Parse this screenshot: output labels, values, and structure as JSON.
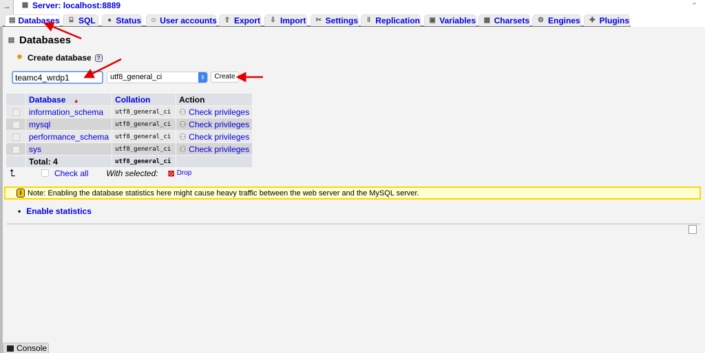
{
  "topbar": {
    "nav_toggle": "→",
    "server_label": "Server: localhost:8889",
    "collapse": "⌃"
  },
  "tabs": [
    {
      "label": "Databases",
      "icon": "database-icon",
      "active": true
    },
    {
      "label": "SQL",
      "icon": "sql-icon"
    },
    {
      "label": "Status",
      "icon": "traffic-light-icon"
    },
    {
      "label": "User accounts",
      "icon": "users-icon"
    },
    {
      "label": "Export",
      "icon": "export-icon"
    },
    {
      "label": "Import",
      "icon": "import-icon"
    },
    {
      "label": "Settings",
      "icon": "tools-icon"
    },
    {
      "label": "Replication",
      "icon": "replication-icon"
    },
    {
      "label": "Variables",
      "icon": "variables-icon"
    },
    {
      "label": "Charsets",
      "icon": "charsets-icon"
    },
    {
      "label": "Engines",
      "icon": "engines-icon"
    },
    {
      "label": "Plugins",
      "icon": "plugin-icon"
    }
  ],
  "page": {
    "title": "Databases"
  },
  "create": {
    "heading": "Create database",
    "help": "?",
    "name_value": "teamc4_wrdp1",
    "collation_value": "utf8_general_ci",
    "button": "Create"
  },
  "table": {
    "headers": {
      "database": "Database",
      "collation": "Collation",
      "action": "Action"
    },
    "rows": [
      {
        "name": "information_schema",
        "collation": "utf8_general_ci",
        "action": "Check privileges"
      },
      {
        "name": "mysql",
        "collation": "utf8_general_ci",
        "action": "Check privileges"
      },
      {
        "name": "performance_schema",
        "collation": "utf8_general_ci",
        "action": "Check privileges"
      },
      {
        "name": "sys",
        "collation": "utf8_general_ci",
        "action": "Check privileges"
      }
    ],
    "total": "Total: 4",
    "total_collation": "utf8_general_ci"
  },
  "footer": {
    "check_all": "Check all",
    "with_selected": "With selected:",
    "drop": "Drop"
  },
  "note": "Note: Enabling the database statistics here might cause heavy traffic between the web server and the MySQL server.",
  "enable_statistics": "Enable statistics",
  "console": "Console",
  "colors": {
    "link": "#0000e0",
    "note_bg": "#ffffd0",
    "note_border": "#ffd700",
    "annotation_arrow": "#e00000"
  }
}
